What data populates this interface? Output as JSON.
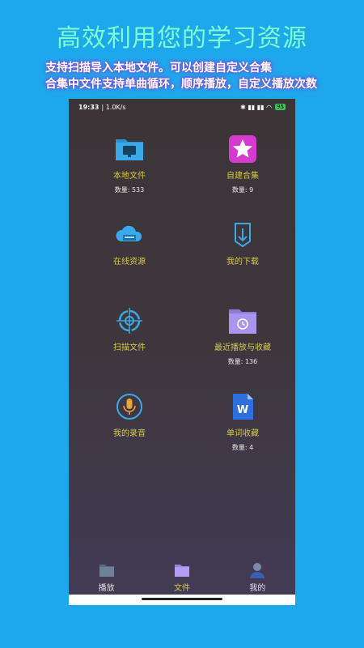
{
  "promo": {
    "title": "高效利用您的学习资源",
    "line1": "支持扫描导入本地文件。可以创建自定义合集",
    "line2": "合集中文件支持单曲循环，顺序播放，自定义播放次数"
  },
  "status": {
    "time": "19:33",
    "net": "| 1.0K/s",
    "icons": "✱ ▮▮ ▮▮ ◠",
    "battery": "95"
  },
  "tiles": [
    {
      "label": "本地文件",
      "count": "数量: 533",
      "icon": "folder-monitor-icon"
    },
    {
      "label": "自建合集",
      "count": "数量: 9",
      "icon": "star-icon"
    },
    {
      "label": "在线资源",
      "count": "",
      "icon": "cloud-icon"
    },
    {
      "label": "我的下载",
      "count": "",
      "icon": "download-icon"
    },
    {
      "label": "扫描文件",
      "count": "",
      "icon": "scan-icon"
    },
    {
      "label": "最近播放与收藏",
      "count": "数量: 136",
      "icon": "recent-folder-icon"
    },
    {
      "label": "我的录音",
      "count": "",
      "icon": "microphone-icon"
    },
    {
      "label": "单词收藏",
      "count": "数量: 4",
      "icon": "word-doc-icon"
    }
  ],
  "tabs": [
    {
      "label": "播放",
      "icon": "folder-play-icon"
    },
    {
      "label": "文件",
      "icon": "folder-icon",
      "active": true
    },
    {
      "label": "我的",
      "icon": "person-icon"
    }
  ],
  "colors": {
    "background": "#1ea8ec",
    "title": "#7dffd0",
    "accent_label": "#d6c84a"
  }
}
